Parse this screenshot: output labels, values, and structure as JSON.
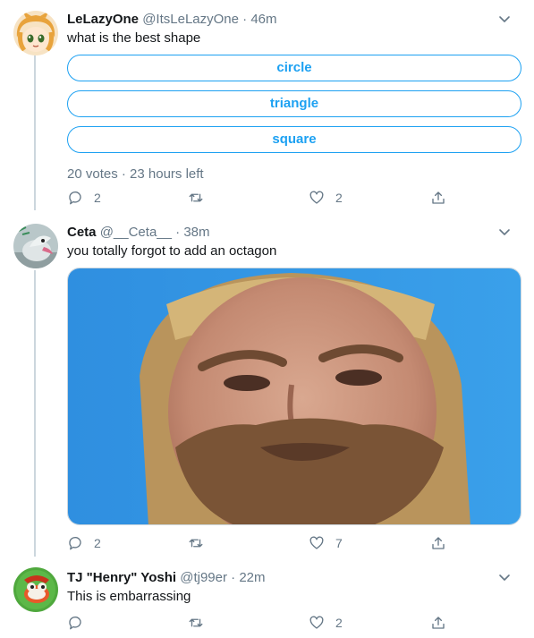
{
  "tweets": [
    {
      "display_name": "LeLazyOne",
      "handle": "@ItsLeLazyOne",
      "separator": "·",
      "time": "46m",
      "text": "what is the best shape",
      "poll": {
        "options": [
          "circle",
          "triangle",
          "square"
        ],
        "meta": "20 votes · 23 hours left"
      },
      "actions": {
        "replies": "2",
        "retweets": "",
        "likes": "2"
      }
    },
    {
      "display_name": "Ceta",
      "handle": "@__Ceta__",
      "separator": "·",
      "time": "38m",
      "text": "you totally forgot to add an octagon",
      "actions": {
        "replies": "2",
        "retweets": "",
        "likes": "7"
      }
    },
    {
      "display_name": "TJ \"Henry\" Yoshi",
      "handle": "@tj99er",
      "separator": "·",
      "time": "22m",
      "text": "This is embarrassing",
      "actions": {
        "replies": "",
        "retweets": "",
        "likes": "2"
      }
    }
  ],
  "icons": {
    "reply": "reply-icon",
    "retweet": "retweet-icon",
    "like": "heart-icon",
    "share": "share-icon",
    "more": "chevron-down-icon"
  },
  "colors": {
    "accent": "#1da1f2",
    "muted": "#657786",
    "thread_line": "#ccd6dd",
    "text": "#14171a"
  }
}
